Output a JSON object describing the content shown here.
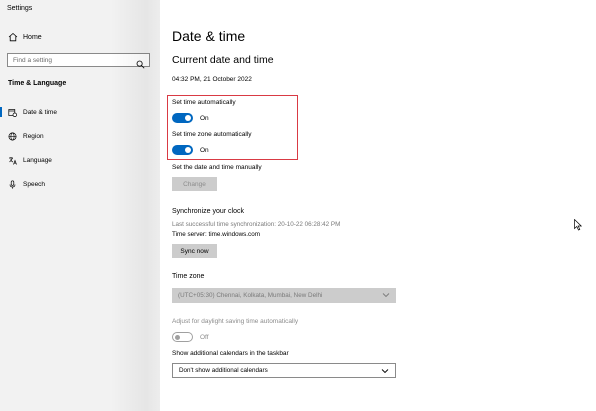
{
  "app": {
    "title": "Settings"
  },
  "sidebar": {
    "home_label": "Home",
    "search_placeholder": "Find a setting",
    "section_title": "Time & Language",
    "items": [
      {
        "label": "Date & time",
        "icon": "calendar-clock-icon",
        "active": true
      },
      {
        "label": "Region",
        "icon": "globe-icon",
        "active": false
      },
      {
        "label": "Language",
        "icon": "language-icon",
        "active": false
      },
      {
        "label": "Speech",
        "icon": "microphone-icon",
        "active": false
      }
    ]
  },
  "main": {
    "page_title": "Date & time",
    "current_heading": "Current date and time",
    "current_value": "04:32 PM, 21 October 2022",
    "auto_time": {
      "label": "Set time automatically",
      "state": "On"
    },
    "auto_zone": {
      "label": "Set time zone automatically",
      "state": "On"
    },
    "manual": {
      "label": "Set the date and time manually",
      "button": "Change"
    },
    "sync": {
      "heading": "Synchronize your clock",
      "last_sync": "Last successful time synchronization: 20-10-22 06:28:42 PM",
      "server": "Time server: time.windows.com",
      "button": "Sync now"
    },
    "timezone": {
      "label": "Time zone",
      "value": "(UTC+05:30) Chennai, Kolkata, Mumbai, New Delhi"
    },
    "daylight": {
      "label": "Adjust for daylight saving time automatically",
      "state": "Off"
    },
    "calendars": {
      "label": "Show additional calendars in the taskbar",
      "value": "Don't show additional calendars"
    }
  },
  "colors": {
    "accent": "#0067c0",
    "highlight_border": "#d93a44",
    "sidebar_bg": "#f2f2f2",
    "button_bg": "#cccccc"
  }
}
